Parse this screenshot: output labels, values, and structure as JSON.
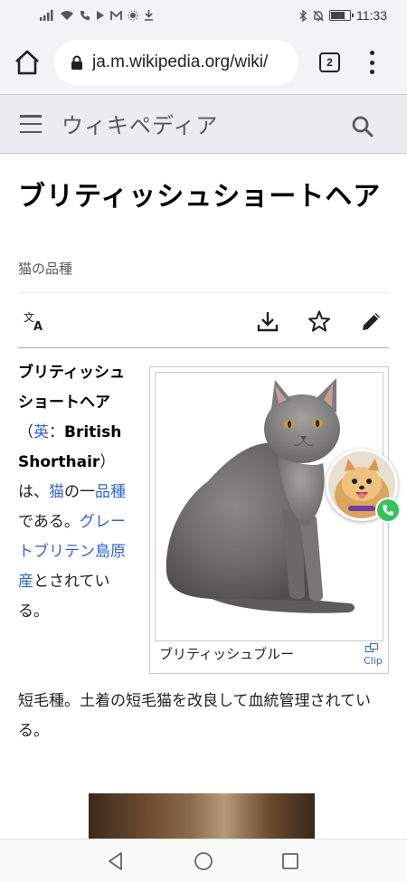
{
  "status_bar": {
    "time": "11:33",
    "battery_level": 0.8
  },
  "browser": {
    "url": "ja.m.wikipedia.org/wiki/",
    "tab_count": "2"
  },
  "wiki": {
    "wordmark": "ウィキペディア"
  },
  "article": {
    "title": "ブリティッシュショートヘア",
    "subtitle": "猫の品種",
    "lead": {
      "bold_title": "ブリティッシュショートヘア",
      "paren_open": "（",
      "lang_link": "英",
      "colon": "：",
      "english_name": "British Shorthair",
      "paren_close": "）",
      "text1": "は、",
      "link_cat": "猫",
      "text2": "の一",
      "link_breed": "品種",
      "text3": "である。",
      "link_place": "グレートブリテン島原産",
      "text4": "とされている。"
    },
    "paragraph2": "短毛種。土着の短毛猫を改良して血統管理されている。"
  },
  "infobox": {
    "caption": "ブリティッシュブルー",
    "clip_label": "Clip"
  },
  "icons": {
    "translate": "translate-icon",
    "download": "download-icon",
    "star": "star-icon",
    "edit": "pencil-icon"
  }
}
